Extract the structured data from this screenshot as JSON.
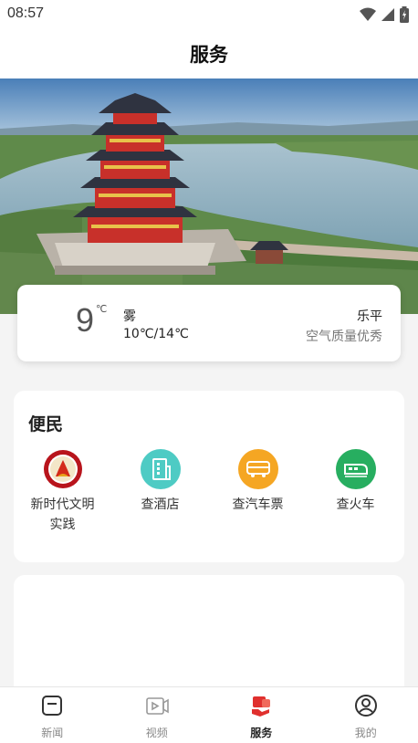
{
  "status_bar": {
    "time": "08:57"
  },
  "header": {
    "title": "服务"
  },
  "weather": {
    "temperature": "9",
    "unit": "℃",
    "condition": "雾",
    "range": "10℃/14℃",
    "city": "乐平",
    "air_quality": "空气质量优秀"
  },
  "services": {
    "title": "便民",
    "items": [
      {
        "label": "新时代文明实践",
        "icon": "civilization-emblem-icon",
        "color": "#b8141c"
      },
      {
        "label": "查酒店",
        "icon": "hotel-icon",
        "color": "#4ecbc4"
      },
      {
        "label": "查汽车票",
        "icon": "bus-icon",
        "color": "#f5a623"
      },
      {
        "label": "查火车",
        "icon": "train-icon",
        "color": "#27ae60"
      }
    ]
  },
  "tabbar": {
    "tabs": [
      {
        "label": "新闻",
        "icon": "news-icon"
      },
      {
        "label": "视频",
        "icon": "video-icon"
      },
      {
        "label": "服务",
        "icon": "service-icon"
      },
      {
        "label": "我的",
        "icon": "profile-icon"
      }
    ],
    "active": "服务",
    "accent": "#e0302e"
  }
}
